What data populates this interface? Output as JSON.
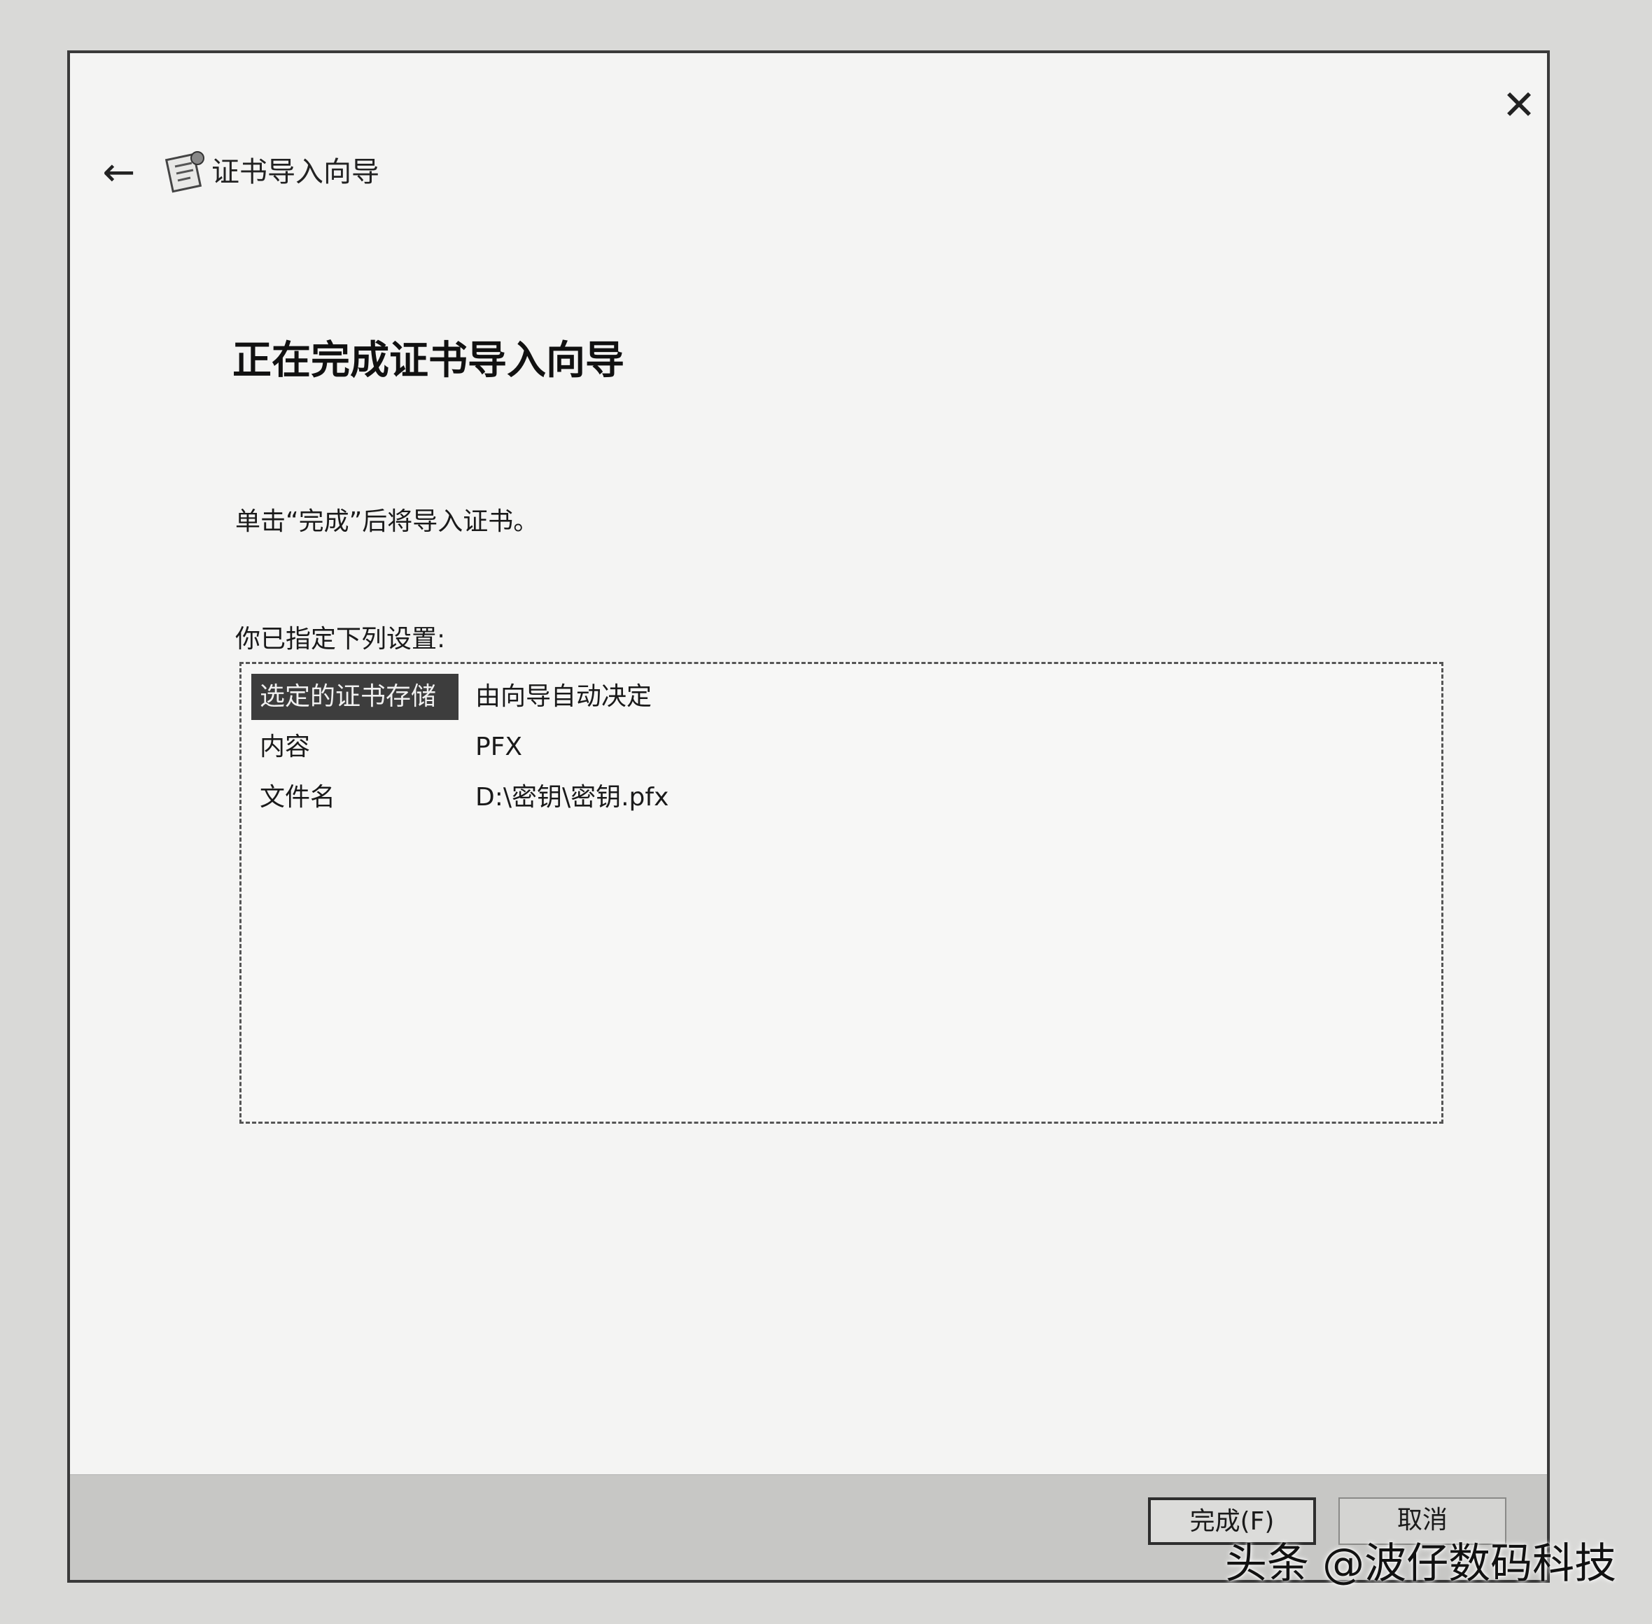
{
  "window": {
    "close_glyph": "✕",
    "back_glyph": "←",
    "title": "证书导入向导"
  },
  "main": {
    "heading": "正在完成证书导入向导",
    "instruction": "单击“完成”后将导入证书。",
    "settings_label": "你已指定下列设置:",
    "settings": [
      {
        "key": "选定的证书存储",
        "value": "由向导自动决定"
      },
      {
        "key": "内容",
        "value": "PFX"
      },
      {
        "key": "文件名",
        "value": "D:\\密钥\\密钥.pfx"
      }
    ]
  },
  "footer": {
    "finish_label": "完成(F)",
    "cancel_label": "取消"
  },
  "watermark": "头条 @波仔数码科技",
  "colors": {
    "selected_row_bg": "#3d3d3d",
    "footer_bg": "#c7c7c5",
    "dialog_bg": "#f4f4f3"
  }
}
